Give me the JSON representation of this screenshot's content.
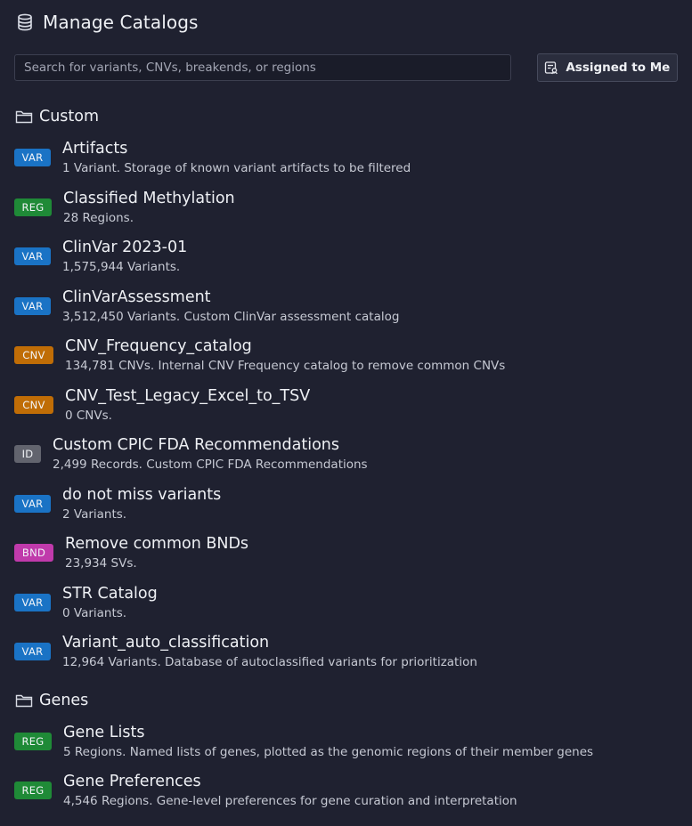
{
  "header": {
    "title": "Manage Catalogs",
    "icon": "database-icon"
  },
  "toolbar": {
    "search_placeholder": "Search for variants, CNVs, breakends, or regions",
    "search_value": "",
    "assigned_label": "Assigned to Me",
    "assigned_icon": "assigned-list-icon"
  },
  "colors": {
    "background": "#1f2130",
    "VAR": "#1a73c5",
    "REG": "#1f8a37",
    "CNV": "#c06d06",
    "ID": "#62646e",
    "BND": "#c03aab"
  },
  "sections": [
    {
      "title": "Custom",
      "icon": "folder-icon",
      "items": [
        {
          "badge": "VAR",
          "name": "Artifacts",
          "desc": "1 Variant. Storage of known variant artifacts to be filtered"
        },
        {
          "badge": "REG",
          "name": "Classified Methylation",
          "desc": "28 Regions."
        },
        {
          "badge": "VAR",
          "name": "ClinVar 2023-01",
          "desc": "1,575,944 Variants."
        },
        {
          "badge": "VAR",
          "name": "ClinVarAssessment",
          "desc": "3,512,450 Variants. Custom ClinVar assessment catalog"
        },
        {
          "badge": "CNV",
          "name": "CNV_Frequency_catalog",
          "desc": "134,781 CNVs. Internal CNV Frequency catalog to remove common CNVs"
        },
        {
          "badge": "CNV",
          "name": "CNV_Test_Legacy_Excel_to_TSV",
          "desc": "0 CNVs."
        },
        {
          "badge": "ID",
          "name": "Custom CPIC FDA Recommendations",
          "desc": "2,499 Records. Custom CPIC FDA Recommendations"
        },
        {
          "badge": "VAR",
          "name": "do not miss variants",
          "desc": "2 Variants."
        },
        {
          "badge": "BND",
          "name": "Remove common BNDs",
          "desc": "23,934 SVs."
        },
        {
          "badge": "VAR",
          "name": "STR Catalog",
          "desc": "0 Variants."
        },
        {
          "badge": "VAR",
          "name": "Variant_auto_classification",
          "desc": "12,964 Variants. Database of autoclassified variants for prioritization"
        }
      ]
    },
    {
      "title": "Genes",
      "icon": "folder-icon",
      "items": [
        {
          "badge": "REG",
          "name": "Gene Lists",
          "desc": "5 Regions. Named lists of genes, plotted as the genomic regions of their member genes"
        },
        {
          "badge": "REG",
          "name": "Gene Preferences",
          "desc": "4,546 Regions. Gene-level preferences for gene curation and interpretation"
        }
      ]
    }
  ]
}
